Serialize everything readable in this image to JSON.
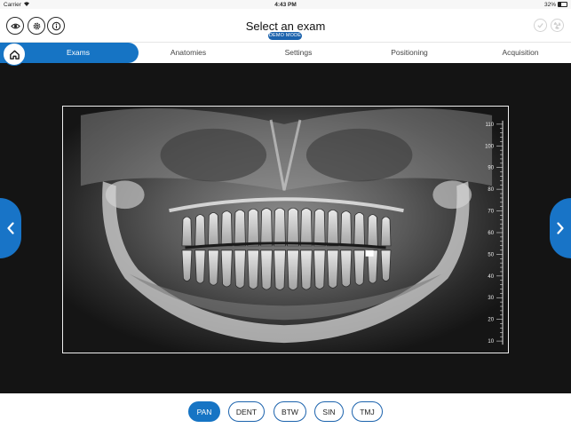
{
  "status_bar": {
    "carrier": "Carrier",
    "time": "4:43 PM",
    "battery_percent": "32%",
    "battery_level": 0.32
  },
  "header": {
    "title": "Select an exam",
    "badge": "DEMO MODE",
    "left_icons": [
      "eye-icon",
      "gear-icon",
      "info-icon"
    ],
    "right_icons": [
      "check-icon",
      "radiation-icon"
    ]
  },
  "tabs": [
    {
      "label": "Exams",
      "active": true
    },
    {
      "label": "Anatomies",
      "active": false
    },
    {
      "label": "Settings",
      "active": false
    },
    {
      "label": "Positioning",
      "active": false
    },
    {
      "label": "Acquisition",
      "active": false
    }
  ],
  "ruler": {
    "labels": [
      "110",
      "100",
      "90",
      "80",
      "70",
      "60",
      "50",
      "40",
      "30",
      "20",
      "10"
    ]
  },
  "exam_buttons": [
    {
      "label": "PAN",
      "selected": true
    },
    {
      "label": "DENT",
      "selected": false
    },
    {
      "label": "BTW",
      "selected": false
    },
    {
      "label": "SIN",
      "selected": false
    },
    {
      "label": "TMJ",
      "selected": false
    }
  ],
  "colors": {
    "accent": "#1674c4",
    "viewer_bg": "#141414"
  }
}
